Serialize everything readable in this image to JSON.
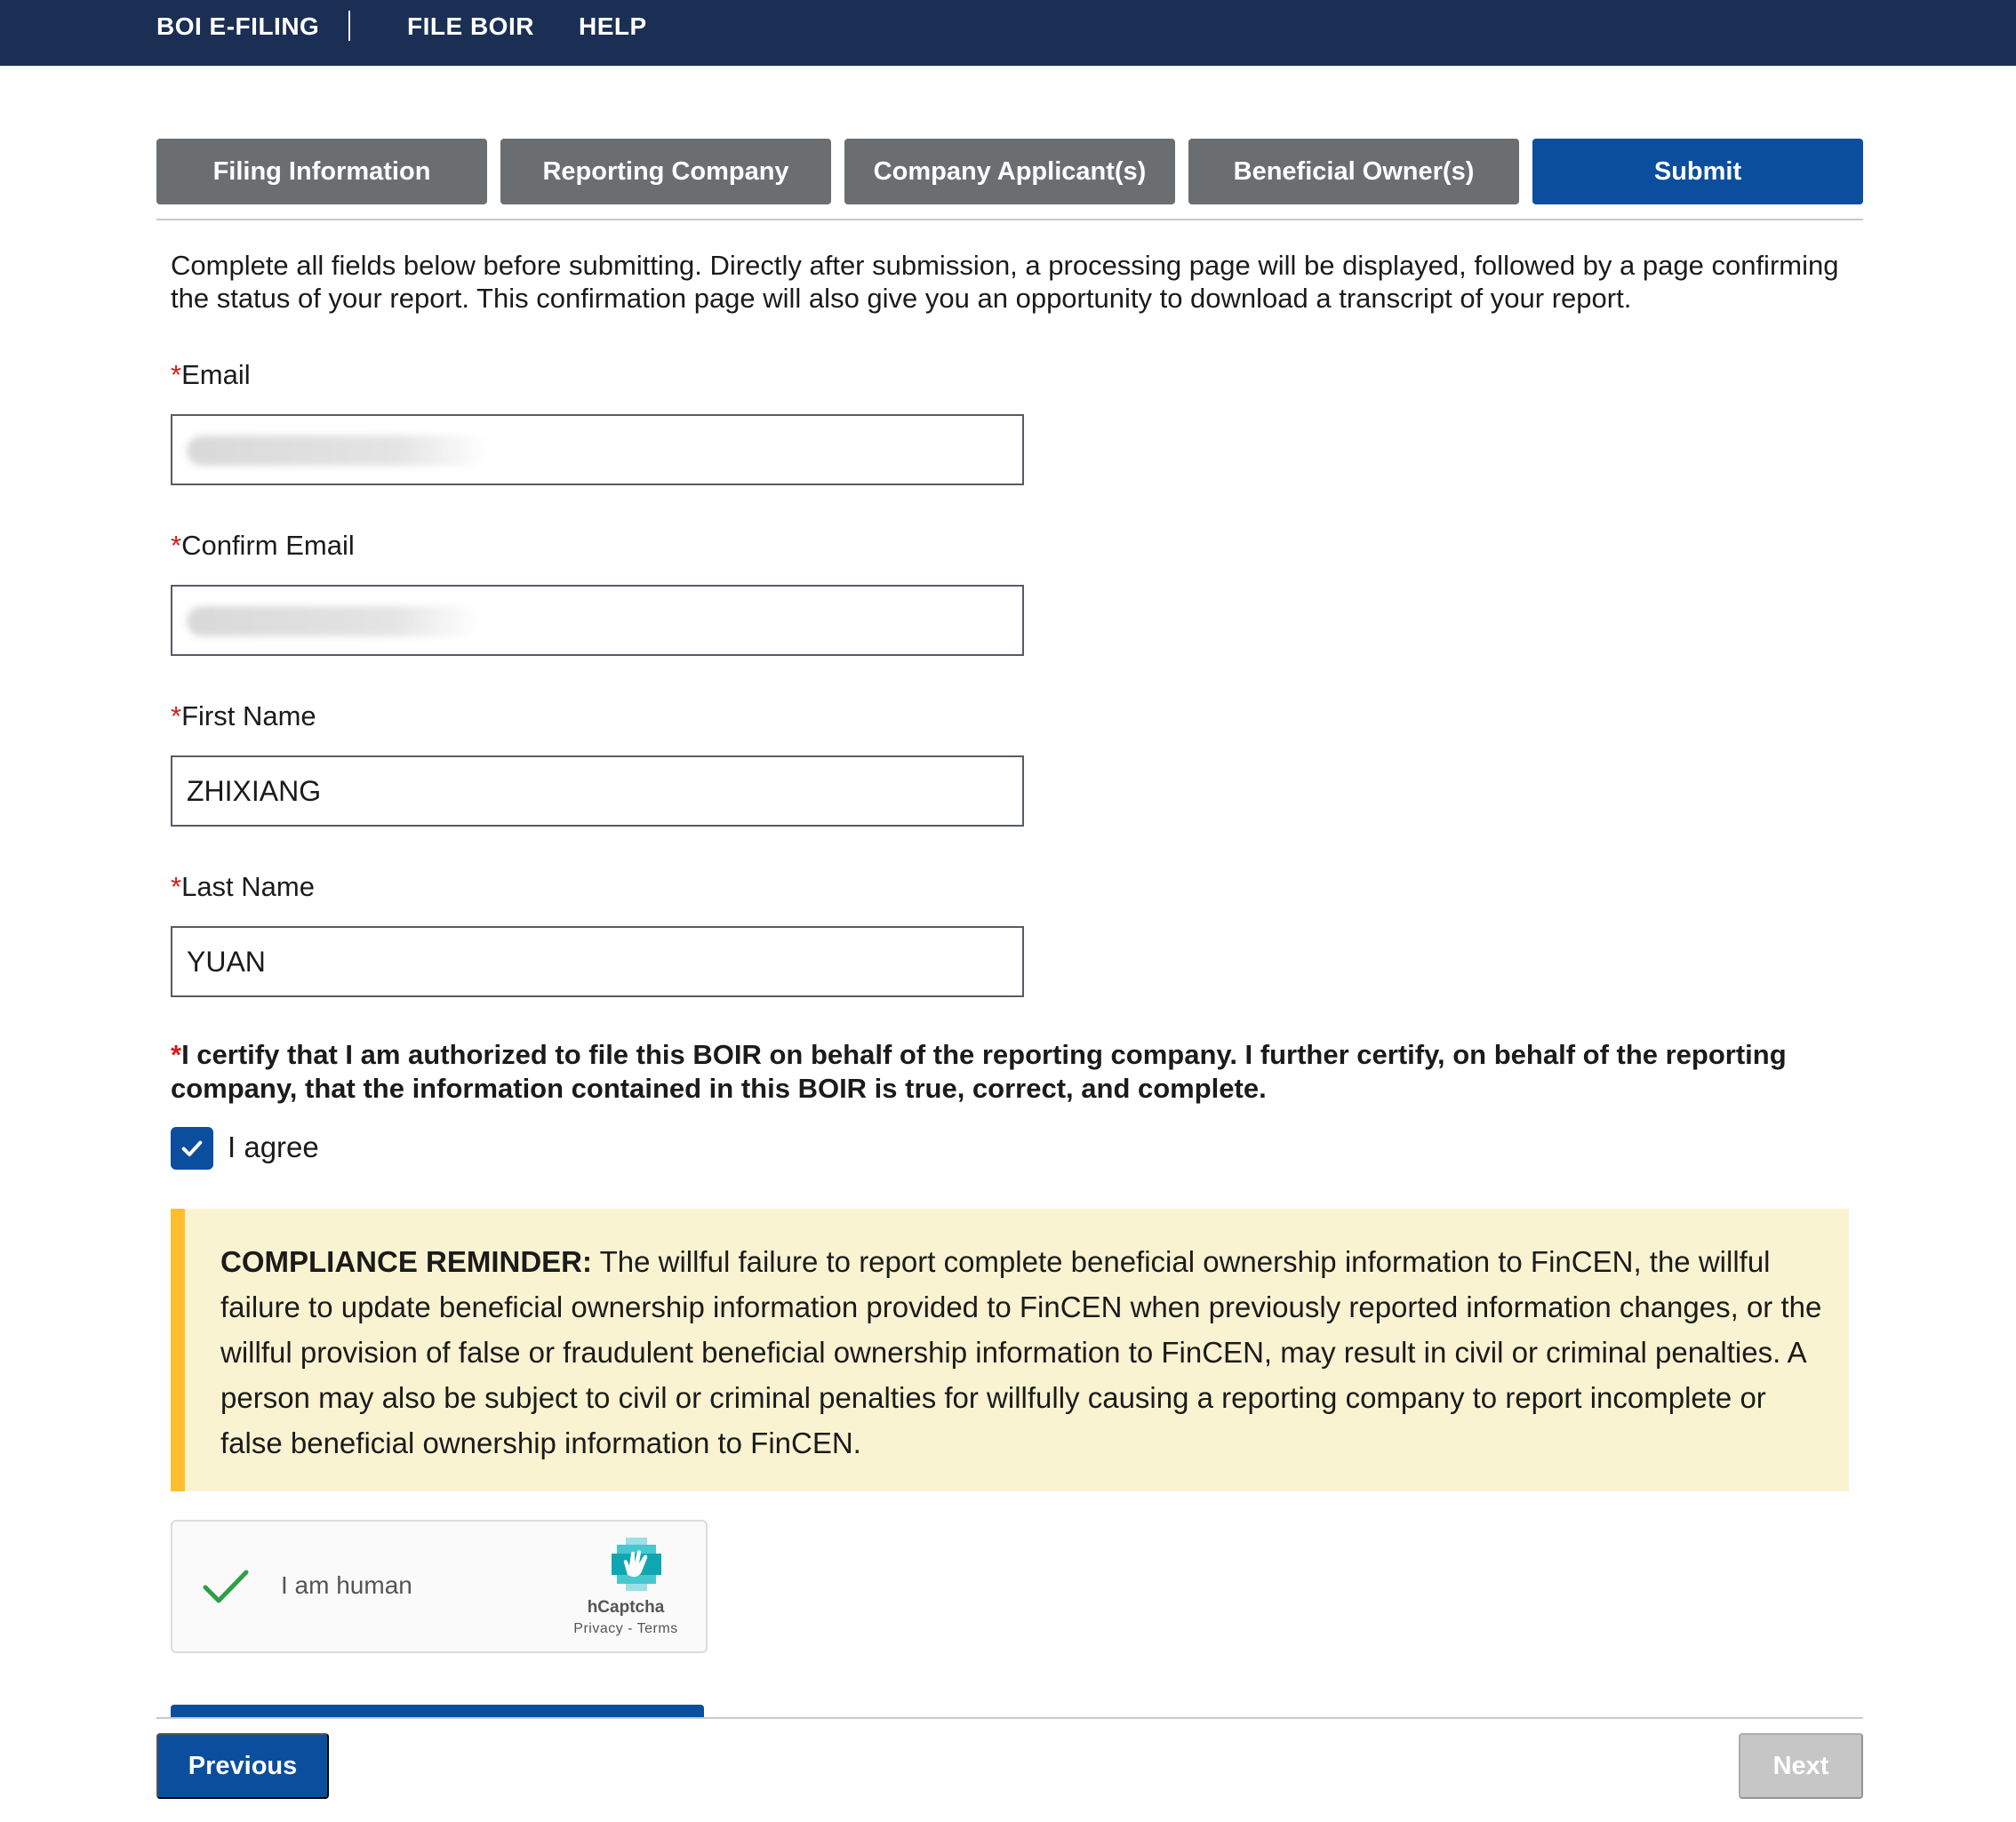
{
  "nav": {
    "brand": "BOI E-FILING",
    "items": [
      "FILE BOIR",
      "HELP"
    ]
  },
  "steps": [
    {
      "label": "Filing Information",
      "active": false
    },
    {
      "label": "Reporting Company",
      "active": false
    },
    {
      "label": "Company Applicant(s)",
      "active": false
    },
    {
      "label": "Beneficial Owner(s)",
      "active": false
    },
    {
      "label": "Submit",
      "active": true
    }
  ],
  "intro": "Complete all fields below before submitting. Directly after submission, a processing page will be displayed, followed by a page confirming the status of your report. This confirmation page will also give you an opportunity to download a transcript of your report.",
  "form": {
    "required_marker": "*",
    "email": {
      "label": "Email",
      "value": ""
    },
    "confirm_email": {
      "label": "Confirm Email",
      "value": ""
    },
    "first_name": {
      "label": "First Name",
      "value": "ZHIXIANG"
    },
    "last_name": {
      "label": "Last Name",
      "value": "YUAN"
    }
  },
  "certification": {
    "text": "I certify that I am authorized to file this BOIR on behalf of the reporting company. I further certify, on behalf of the reporting company, that the information contained in this BOIR is true, correct, and complete.",
    "agree_label": "I agree",
    "checked": true
  },
  "compliance": {
    "heading": "COMPLIANCE REMINDER:",
    "body": "The willful failure to report complete beneficial ownership information to FinCEN, the willful failure to update beneficial ownership information provided to FinCEN when previously reported information changes, or the willful provision of false or fraudulent beneficial ownership information to FinCEN, may result in civil or criminal penalties. A person may also be subject to civil or criminal penalties for willfully causing a reporting company to report incomplete or false beneficial ownership information to FinCEN."
  },
  "captcha": {
    "label": "I am human",
    "brand": "hCaptcha",
    "privacy": "Privacy",
    "separator": " - ",
    "terms": "Terms",
    "verified": true
  },
  "buttons": {
    "previous": "Previous",
    "next": "Next"
  },
  "colors": {
    "navy": "#1b2f55",
    "primary": "#0b4e9e",
    "step_inactive": "#6b6e71",
    "alert_bg": "#faf3d1",
    "alert_border": "#ffbe2e",
    "required": "#d31b1b",
    "disabled": "#c6c6c6"
  }
}
